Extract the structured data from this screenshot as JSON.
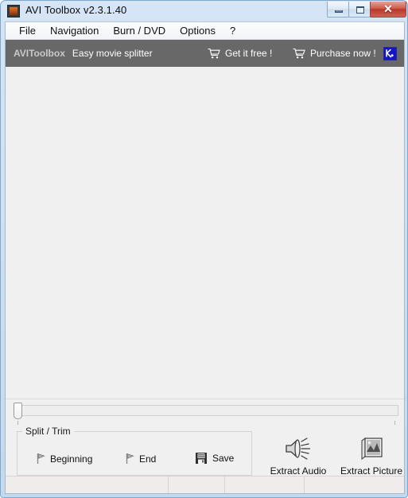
{
  "window": {
    "title": "AVI Toolbox v2.3.1.40",
    "app_icon": "film-frame-icon",
    "controls": {
      "minimize": "minimize-button",
      "maximize": "maximize-button",
      "close_label": "✕"
    }
  },
  "menubar": {
    "items": [
      {
        "label": "File"
      },
      {
        "label": "Navigation"
      },
      {
        "label": "Burn / DVD"
      },
      {
        "label": "Options"
      },
      {
        "label": "?"
      }
    ]
  },
  "banner": {
    "brand": "AVIToolbox",
    "tagline": "Easy movie splitter",
    "background_color": "#686868",
    "links": [
      {
        "label": "Get it free !",
        "icon": "shopping-cart-icon"
      },
      {
        "label": "Purchase now !",
        "icon": "shopping-cart-icon"
      }
    ],
    "corner_icon": {
      "name": "k-logo-icon",
      "color": "#1414c8",
      "glyph": "K"
    }
  },
  "video_area": {
    "background_color": "#f0f0f0",
    "content": ""
  },
  "seek_bar": {
    "name": "video-position-slider",
    "value": 0,
    "min": 0,
    "max": 100
  },
  "split_trim": {
    "group_label": "Split / Trim",
    "buttons": [
      {
        "label": "Beginning",
        "icon": "flag-icon"
      },
      {
        "label": "End",
        "icon": "flag-icon"
      },
      {
        "label": "Save",
        "icon": "floppy-disk-icon"
      }
    ]
  },
  "extract_buttons": [
    {
      "label": "Extract Audio",
      "icon": "speaker-icon"
    },
    {
      "label": "Extract Picture",
      "icon": "photo-stack-icon"
    }
  ],
  "progress_bar": {
    "name": "operation-progress",
    "value": 0
  },
  "statusbar": {
    "panes": [
      "",
      "",
      "",
      ""
    ],
    "grip": "resize-grip-icon"
  }
}
